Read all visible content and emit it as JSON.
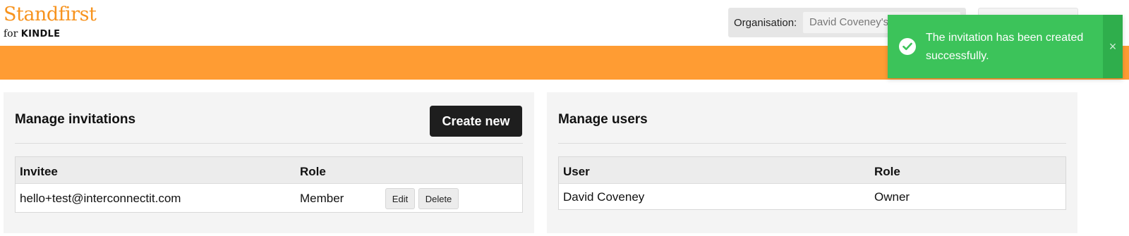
{
  "brand": {
    "logo_main": "Standfirst",
    "logo_for": "for",
    "logo_product": "KINDLE",
    "accent_color": "#f7931e",
    "bar_color": "#ff9c33"
  },
  "header": {
    "organisation_label": "Organisation:",
    "organisation_value": "David Coveney's"
  },
  "invitations": {
    "title": "Manage invitations",
    "create_button": "Create new",
    "columns": [
      "Invitee",
      "Role"
    ],
    "rows": [
      {
        "invitee": "hello+test@interconnectit.com",
        "role": "Member",
        "edit": "Edit",
        "delete": "Delete"
      }
    ]
  },
  "users": {
    "title": "Manage users",
    "columns": [
      "User",
      "Role"
    ],
    "rows": [
      {
        "user": "David Coveney",
        "role": "Owner"
      }
    ]
  },
  "toast": {
    "message": "The invitation has been created successfully.",
    "close_icon": "×",
    "icon": "check-circle-icon",
    "color": "#3cc35a"
  }
}
